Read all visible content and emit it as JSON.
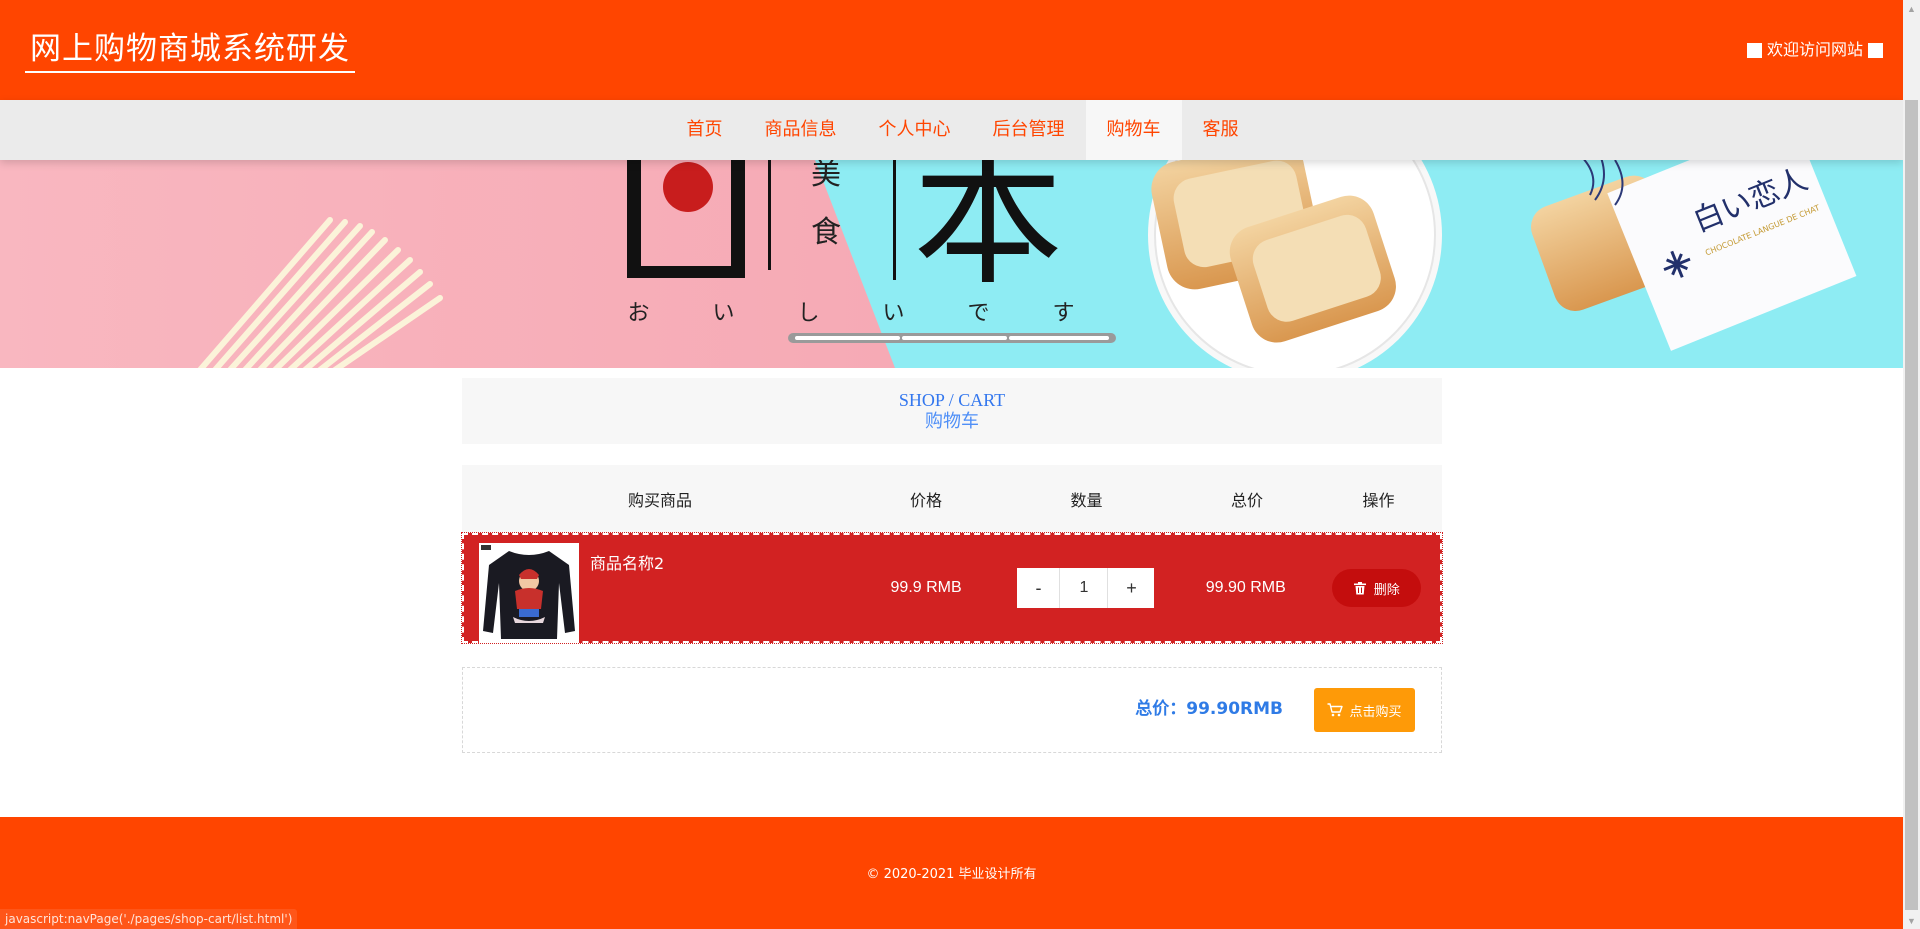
{
  "header": {
    "site_title": "网上购物商城系统研发",
    "welcome_text": "欢迎访问网站"
  },
  "nav": {
    "items": [
      {
        "label": "首页"
      },
      {
        "label": "商品信息"
      },
      {
        "label": "个人中心"
      },
      {
        "label": "后台管理"
      },
      {
        "label": "购物车",
        "active": true
      },
      {
        "label": "客服"
      }
    ]
  },
  "banner": {
    "headline_chars": [
      "日",
      "美",
      "食",
      "本"
    ],
    "subtitle": "お い し い で す",
    "package_text": "白い恋人",
    "package_small": "CHOCOLATE LANGUE DE CHAT",
    "slide_count": 3
  },
  "section": {
    "title_en": "SHOP / CART",
    "title_cn": "购物车"
  },
  "table": {
    "headers": {
      "product": "购买商品",
      "price": "价格",
      "quantity": "数量",
      "total": "总价",
      "action": "操作"
    },
    "rows": [
      {
        "name": "商品名称2",
        "price": "99.9 RMB",
        "qty_minus": "-",
        "quantity": "1",
        "qty_plus": "+",
        "total": "99.90 RMB",
        "delete_label": "删除"
      }
    ]
  },
  "summary": {
    "total_label": "总价：99.90RMB",
    "buy_label": "点击购买"
  },
  "footer": {
    "copyright": "© 2020-2021 毕业设计所有",
    "status_url": "javascript:navPage('./pages/shop-cart/list.html')"
  },
  "colors": {
    "brand": "#ff4500",
    "row_highlight": "#d22222",
    "delete_button": "#c40d0d",
    "buy_button": "#fe9a08",
    "total_text": "#2f7be6",
    "section_title": "#3377ee"
  },
  "icons": {
    "delete": "trash-icon",
    "buy": "cart-icon",
    "welcome_left": "square-icon",
    "welcome_right": "square-icon"
  }
}
